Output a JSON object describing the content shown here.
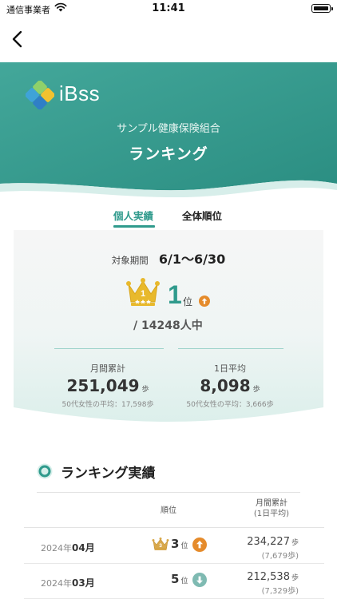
{
  "status_bar": {
    "carrier": "通信事業者",
    "time": "11:41"
  },
  "brand": {
    "logo_text": "iBss",
    "org_name": "サンプル健康保険組合",
    "page_title": "ランキング"
  },
  "tabs": [
    {
      "label": "個人実績",
      "active": true
    },
    {
      "label": "全体順位",
      "active": false
    }
  ],
  "summary": {
    "period_label": "対象期間",
    "period_value": "6/1〜6/30",
    "crown_rank": "1",
    "rank": "1",
    "rank_unit": "位",
    "rank_trend": "up",
    "total_participants": "/ 14248人中",
    "monthly_label": "月間累計",
    "monthly_value": "251,049",
    "monthly_unit": "歩",
    "monthly_avg": "50代女性の平均：17,598歩",
    "daily_label": "1日平均",
    "daily_value": "8,098",
    "daily_unit": "歩",
    "daily_avg": "50代女性の平均：3,666歩"
  },
  "ranking_history": {
    "title": "ランキング実績",
    "col_rank": "順位",
    "col_monthly": "月間累計",
    "col_monthly_sub": "(1日平均)",
    "rows": [
      {
        "year": "2024年",
        "month": "04月",
        "crown": "3",
        "rank": "3",
        "rank_unit": "位",
        "trend": "up",
        "steps": "234,227",
        "steps_unit": "歩",
        "daily": "(7,679歩)"
      },
      {
        "year": "2024年",
        "month": "03月",
        "crown": "",
        "rank": "5",
        "rank_unit": "位",
        "trend": "down",
        "steps": "212,538",
        "steps_unit": "歩",
        "daily": "(7,329歩)"
      }
    ]
  },
  "colors": {
    "teal": "#2f9a8c",
    "hero_start": "#3fa597",
    "hero_end": "#2c8f83",
    "gold": "#e8b92c",
    "up_orange": "#e58b2b",
    "down_teal": "#7fbab2"
  },
  "icons": [
    "back-chevron-icon",
    "wifi-icon",
    "battery-icon",
    "ibss-logo-icon",
    "crown-icon",
    "arrow-up-icon",
    "arrow-down-icon",
    "ring-icon"
  ]
}
